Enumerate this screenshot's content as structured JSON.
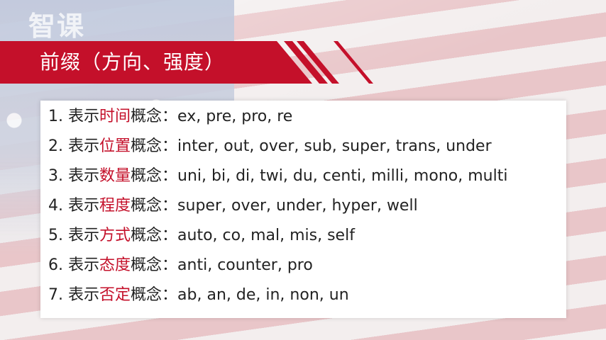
{
  "watermark": "智课",
  "title": "前缀（方向、强度）",
  "items": [
    {
      "num": "1.",
      "pre": "表示",
      "hl": "时间",
      "post": "概念：",
      "examples": "ex, pre, pro, re"
    },
    {
      "num": "2.",
      "pre": "表示",
      "hl": "位置",
      "post": "概念：",
      "examples": "inter, out, over, sub, super, trans, under"
    },
    {
      "num": "3.",
      "pre": "表示",
      "hl": "数量",
      "post": "概念：",
      "examples": "uni, bi, di, twi, du, centi, milli, mono, multi"
    },
    {
      "num": "4.",
      "pre": "表示",
      "hl": "程度",
      "post": "概念：",
      "examples": "super, over, under, hyper, well"
    },
    {
      "num": "5.",
      "pre": "表示",
      "hl": "方式",
      "post": "概念：",
      "examples": "auto, co, mal, mis, self"
    },
    {
      "num": "6.",
      "pre": "表示",
      "hl": "态度",
      "post": "概念：",
      "examples": "anti, counter, pro"
    },
    {
      "num": "7.",
      "pre": "表示",
      "hl": "否定",
      "post": "概念：",
      "examples": "ab, an, de, in, non, un"
    }
  ],
  "colors": {
    "accent": "#c4102a",
    "text": "#222222"
  }
}
